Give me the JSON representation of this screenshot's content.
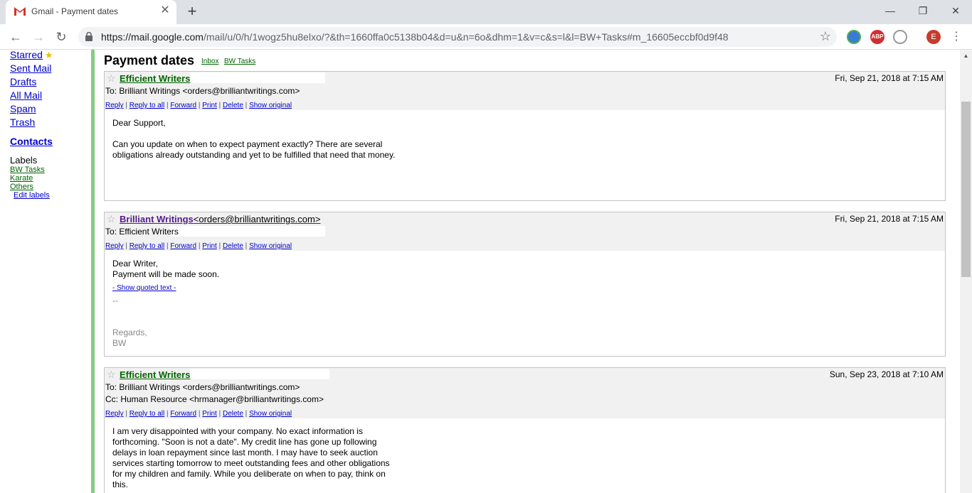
{
  "browser": {
    "tab_title": "Gmail - Payment dates",
    "url_host": "https://mail.google.com",
    "url_rest": "/mail/u/0/h/1wogz5hu8elxo/?&th=1660ffa0c5138b04&d=u&n=6o&dhm=1&v=c&s=l&l=BW+Tasks#m_16605eccbf0d9f48",
    "profile_initial": "E",
    "abp_label": "ABP"
  },
  "sidebar": {
    "starred": "Starred",
    "sent": "Sent Mail",
    "drafts": "Drafts",
    "all": "All Mail",
    "spam": "Spam",
    "trash": "Trash",
    "contacts": "Contacts",
    "labels_heading": "Labels",
    "labels": [
      "BW Tasks",
      "Karate",
      "Others"
    ],
    "edit_labels": "Edit labels"
  },
  "thread": {
    "subject": "Payment dates",
    "labels": [
      "Inbox",
      "BW Tasks"
    ]
  },
  "actions": {
    "reply": "Reply",
    "reply_all": "Reply to all",
    "forward": "Forward",
    "print": "Print",
    "delete": "Delete",
    "show_original": "Show original",
    "sep": "|"
  },
  "messages": [
    {
      "sender": "Efficient Writers",
      "date": "Fri, Sep 21, 2018 at 7:15 AM",
      "to": "To: Brilliant Writings <orders@brilliantwritings.com>",
      "body": [
        "Dear Support,",
        "Can you update on when to expect payment exactly? There are several obligations already outstanding and yet to be fulfilled that need that money."
      ]
    },
    {
      "sender": "Brilliant Writings",
      "sender_email": "<orders@brilliantwritings.com>",
      "date": "Fri, Sep 21, 2018 at 7:15 AM",
      "to": "To: Efficient Writers",
      "body_line1": "Dear Writer,",
      "body_line2": "Payment will be made soon.",
      "show_quoted": "- Show quoted text -",
      "sig_dash": "--",
      "sig_regards": "Regards,",
      "sig_name": "BW"
    },
    {
      "sender": "Efficient Writers",
      "date": "Sun, Sep 23, 2018 at 7:10 AM",
      "to": "To: Brilliant Writings <orders@brilliantwritings.com>",
      "cc": "Cc: Human Resource <hrmanager@brilliantwritings.com>",
      "body": "I am very disappointed with your company. No exact information is forthcoming. \"Soon is not a date\". My credit line has gone up following delays in loan repayment since last month. I may have to seek auction services starting tomorrow to meet outstanding fees and other obligations for my children and family. While you deliberate on when to pay, think on this."
    }
  ]
}
